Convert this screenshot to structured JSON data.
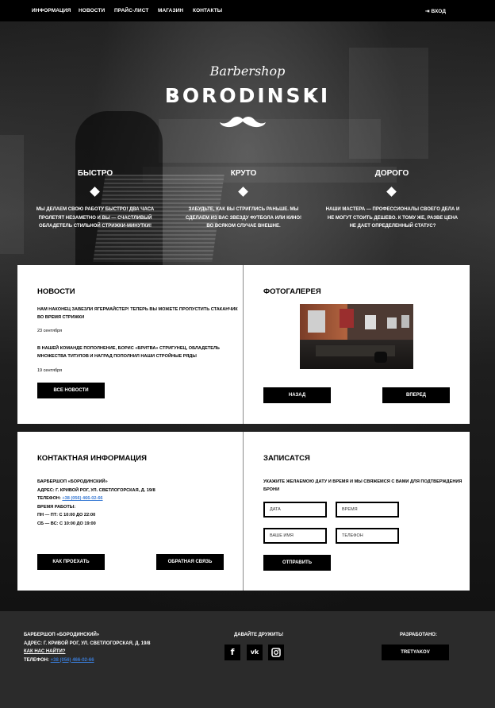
{
  "nav": {
    "items": [
      "ИНФОРМАЦИЯ",
      "НОВОСТИ",
      "ПРАЙС-ЛИСТ",
      "МАГАЗИН",
      "КОНТАКТЫ"
    ],
    "login": "ВХОД"
  },
  "hero": {
    "script": "Barbershop",
    "brand": "BORODINSKI",
    "features": [
      {
        "title": "БЫСТРО",
        "lines": [
          "МЫ ДЕЛАЕМ СВОЮ РАБОТУ БЫСТРО! ДВА ЧАСА",
          "ПРОЛЕТЯТ НЕЗАМЕТНО И ВЫ — СЧАСТЛИВЫЙ",
          "ОБЛАДЕТЕЛЬ СТИЛЬНОЙ СТРИЖКИ-МИНУТКИ!"
        ]
      },
      {
        "title": "КРУТО",
        "lines": [
          "ЗАБУДЬТЕ, КАК ВЫ СТРИГЛИСЬ РАНЬШЕ. МЫ",
          "СДЕЛАЕМ ИЗ ВАС ЗВЕЗДУ ФУТБОЛА ИЛИ КИНО!",
          "ВО ВСЯКОМ СЛУЧАЕ ВНЕШНЕ."
        ]
      },
      {
        "title": "ДОРОГО",
        "lines": [
          "НАШИ МАСТЕРА — ПРОФЕССИОНАЛЫ СВОЕГО ДЕЛА И",
          "НЕ МОГУТ СТОИТЬ ДЕШЕВО. К ТОМУ ЖЕ, РАЗВЕ ЦЕНА",
          "НЕ ДАЕТ ОПРЕДЕЛЕННЫЙ СТАТУС?"
        ]
      }
    ]
  },
  "news": {
    "title": "НОВОСТИ",
    "items": [
      {
        "lines": [
          "НАМ НАКОНЕЦ ЗАВЕЗЛИ ЯГЕРМАЙСТЕР! ТЕПЕРЬ ВЫ МОЖЕТЕ ПРОПУСТИТЬ СТАКАНЧИК",
          "ВО ВРЕМЯ СТРИЖКИ"
        ],
        "date": "23 сентября"
      },
      {
        "lines": [
          "В НАШЕЙ КОМАНДЕ ПОПОЛНЕНИЕ, БОРИС «БРИТВА» СТРИГУНЕЦ, ОБЛАДЕТЕЛЬ",
          "МНОЖЕСТВА ТИТУЛОВ И НАГРАД ПОПОЛНИЛ НАШИ СТРОЙНЫЕ РЯДЫ"
        ],
        "date": "19 сентября"
      }
    ],
    "all_button": "ВСЕ НОВОСТИ"
  },
  "gallery": {
    "title": "ФОТОГАЛЕРЕЯ",
    "prev_button": "НАЗАД",
    "next_button": "ВПЕРЕД"
  },
  "contacts": {
    "title": "КОНТАКТНАЯ ИНФОРМАЦИЯ",
    "name": "БАРБЕРШОП «БОРОДИНСКИЙ»",
    "address": "АДРЕС: Г. КРИВОЙ РОГ, УЛ. СВЕТЛОГОРСКАЯ, Д. 19/8",
    "phone_label": "ТЕЛЕФОН: ",
    "phone": "+38 (056) 466-02-66",
    "hours_title": "ВРЕМЯ РАБОТЫ:",
    "hours_weekdays": "ПН — ПТ: С 10:00 ДО 22:00",
    "hours_weekend": "СБ — ВС: С 10:00 ДО 19:00",
    "route_button": "КАК ПРОЕХАТЬ",
    "feedback_button": "ОБРАТНАЯ СВЯЗЬ"
  },
  "booking": {
    "title": "ЗАПИСАТСЯ",
    "lines": [
      "УКАЖИТЕ ЖЕЛАЕМОЮ ДАТУ И ВРЕМЯ И МЫ СВЯЖЕМСЯ С ВАМИ ДЛЯ ПОДТВЕРЖДЕНИЯ",
      "БРОНИ"
    ],
    "date_placeholder": "ДАТА",
    "time_placeholder": "ВРЕМЯ",
    "name_placeholder": "ВАШЕ ИМЯ",
    "phone_placeholder": "ТЕЛЕФОН",
    "submit_button": "ОТПРАВИТЬ"
  },
  "footer": {
    "name": "БАРБЕРШОП «БОРОДИНСКИЙ»",
    "address": "АДРЕС: Г. КРИВОЙ РОГ, УЛ. СВЕТЛОГОРСКАЯ, Д. 19/8",
    "find_link": "КАК НАС НАЙТИ?",
    "phone_label": "ТЕЛЕФОН: ",
    "phone": "+38 (056) 466-02-66",
    "social_title": "ДАВАЙТЕ ДРУЖИТЬ!",
    "social_icons": [
      "facebook-icon",
      "vk-icon",
      "instagram-icon"
    ],
    "dev_title": "РАЗРАБОТАНО:",
    "dev_button": "TRETYAKOV"
  },
  "colors": {
    "accent": "#000000",
    "link": "#3a7bd5",
    "footer_bg": "#2b2b2b"
  }
}
